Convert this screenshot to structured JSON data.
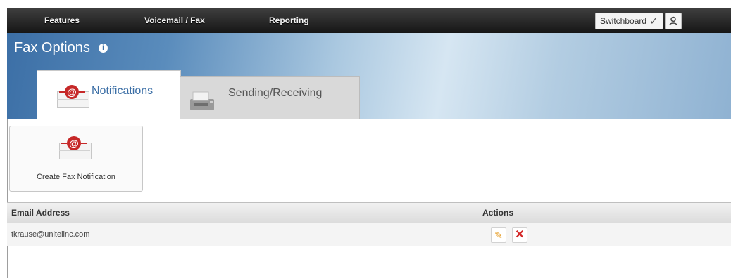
{
  "topnav": {
    "items": [
      {
        "label": "Features"
      },
      {
        "label": "Voicemail / Fax"
      },
      {
        "label": "Reporting"
      }
    ],
    "switchboard_label": "Switchboard",
    "switchboard_check": "✓",
    "user_icon": "user-icon"
  },
  "page": {
    "title": "Fax Options",
    "info_icon": "info-icon"
  },
  "tabs": [
    {
      "label": "Notifications",
      "icon": "email-notification-icon",
      "active": true
    },
    {
      "label": "Sending/Receiving",
      "icon": "fax-machine-icon",
      "active": false
    }
  ],
  "create_button": {
    "label": "Create Fax Notification",
    "icon": "email-notification-icon"
  },
  "table": {
    "columns": [
      "Email Address",
      "Actions"
    ],
    "rows": [
      {
        "email": "tkrause@unitelinc.com",
        "actions": [
          "edit-icon",
          "delete-icon"
        ]
      }
    ]
  },
  "colors": {
    "nav_bg": "#222222",
    "hero_blue": "#3c6fa6",
    "badge_red": "#c62828",
    "delete_red": "#d32626",
    "edit_orange": "#e69a1f"
  }
}
